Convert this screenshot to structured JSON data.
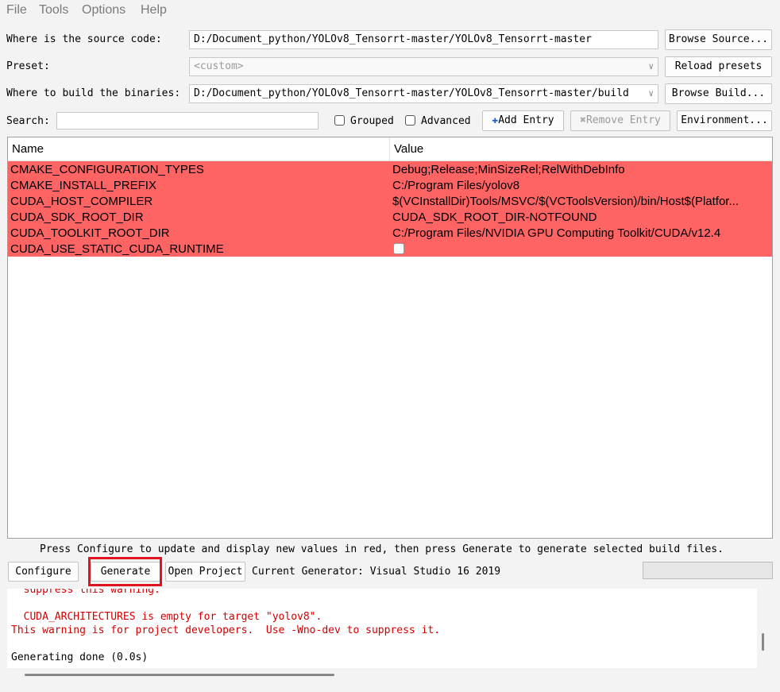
{
  "menu": [
    "File",
    "Tools",
    "Options",
    "Help"
  ],
  "source": {
    "label": "Where is the source code:",
    "value": "D:/Document_python/YOLOv8_Tensorrt-master/YOLOv8_Tensorrt-master",
    "browse_label": "Browse Source..."
  },
  "preset": {
    "label": "Preset:",
    "value": "<custom>",
    "reload_label": "Reload presets"
  },
  "build": {
    "label": "Where to build the binaries:",
    "value": "D:/Document_python/YOLOv8_Tensorrt-master/YOLOv8_Tensorrt-master/build",
    "browse_label": "Browse Build..."
  },
  "search": {
    "label": "Search:",
    "value": "",
    "grouped_label": "Grouped",
    "grouped_checked": false,
    "advanced_label": "Advanced",
    "advanced_checked": false,
    "add_entry_label": "Add Entry",
    "remove_entry_label": "Remove Entry",
    "environment_label": "Environment..."
  },
  "table": {
    "headers": [
      "Name",
      "Value"
    ],
    "rows": [
      {
        "name": "CMAKE_CONFIGURATION_TYPES",
        "value": "Debug;Release;MinSizeRel;RelWithDebInfo"
      },
      {
        "name": "CMAKE_INSTALL_PREFIX",
        "value": "C:/Program Files/yolov8"
      },
      {
        "name": "CUDA_HOST_COMPILER",
        "value": "$(VCInstallDir)Tools/MSVC/$(VCToolsVersion)/bin/Host$(Platfor..."
      },
      {
        "name": "CUDA_SDK_ROOT_DIR",
        "value": "CUDA_SDK_ROOT_DIR-NOTFOUND"
      },
      {
        "name": "CUDA_TOOLKIT_ROOT_DIR",
        "value": "C:/Program Files/NVIDIA GPU Computing Toolkit/CUDA/v12.4"
      },
      {
        "name": "CUDA_USE_STATIC_CUDA_RUNTIME",
        "value": "",
        "checkbox": true,
        "checked": false
      }
    ],
    "row_color": "#ff6464"
  },
  "hint": "Press Configure to update and display new values in red, then press Generate to generate selected build files.",
  "actions": {
    "configure_label": "Configure",
    "generate_label": "Generate",
    "open_project_label": "Open Project",
    "current_generator": "Current Generator: Visual Studio 16 2019"
  },
  "output": [
    {
      "text": "  suppress this warning.",
      "color": "red"
    },
    {
      "text": "",
      "color": "black"
    },
    {
      "text": "  CUDA_ARCHITECTURES is empty for target \"yolov8\".",
      "color": "red"
    },
    {
      "text": "This warning is for project developers.  Use -Wno-dev to suppress it.",
      "color": "red"
    },
    {
      "text": "",
      "color": "black"
    },
    {
      "text": "Generating done (0.0s)",
      "color": "black"
    }
  ],
  "colors": {
    "highlight": "#e0141e",
    "warning_text": "#d40000"
  }
}
